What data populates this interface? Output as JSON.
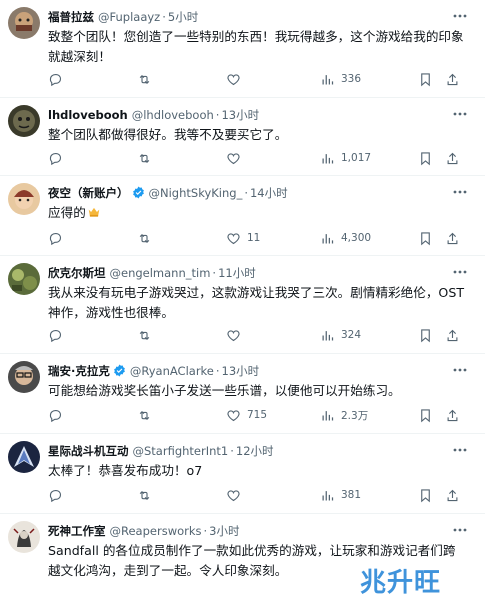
{
  "colors": {
    "text": "#0f1419",
    "muted": "#536471",
    "verified": "#1d9bf0",
    "divider": "#eff3f4",
    "watermark": "#2f8ad9"
  },
  "icons": {
    "reply": "reply-icon",
    "retweet": "retweet-icon",
    "like": "heart-icon",
    "views": "views-icon",
    "bookmark": "bookmark-icon",
    "share": "share-icon",
    "more": "more-icon",
    "verified": "verified-badge-icon"
  },
  "tweets": [
    {
      "name": "福普拉兹",
      "handle": "@Fuplaayz",
      "time": "5小时",
      "text": "致整个团队！您创造了一些特别的东西！我玩得越多，这个游戏给我的印象就越深刻！",
      "likes": "",
      "views": "336"
    },
    {
      "name": "lhdlovebooh",
      "handle": "@lhdlovebooh",
      "time": "13小时",
      "text": "整个团队都做得很好。我等不及要买它了。",
      "likes": "",
      "views": "1,017"
    },
    {
      "name": "夜空（新账户）",
      "handle": "@NightSkyKing_",
      "time": "14小时",
      "text": "应得的",
      "likes": "11",
      "views": "4,300"
    },
    {
      "name": "欣克尔斯坦",
      "handle": "@engelmann_tim",
      "time": "11小时",
      "text": "我从来没有玩电子游戏哭过，这款游戏让我哭了三次。剧情精彩绝伦，OST 神作，游戏性也很棒。",
      "likes": "",
      "views": "324"
    },
    {
      "name": "瑞安·克拉克",
      "handle": "@RyanAClarke",
      "time": "13小时",
      "text": "可能想给游戏奖长笛小子发送一些乐谱，以便他可以开始练习。",
      "likes": "715",
      "views": "2.3万"
    },
    {
      "name": "星际战斗机互动",
      "handle": "@StarfighterInt1",
      "time": "12小时",
      "text": "太棒了！恭喜发布成功！o7",
      "likes": "",
      "views": "381"
    },
    {
      "name": "死神工作室",
      "handle": "@Reapersworks",
      "time": "3小时",
      "text": "Sandfall 的各位成员制作了一款如此优秀的游戏，让玩家和游戏记者们跨越文化鸿沟，走到了一起。令人印象深刻。",
      "likes": "",
      "views": ""
    }
  ],
  "watermark": "兆升旺"
}
